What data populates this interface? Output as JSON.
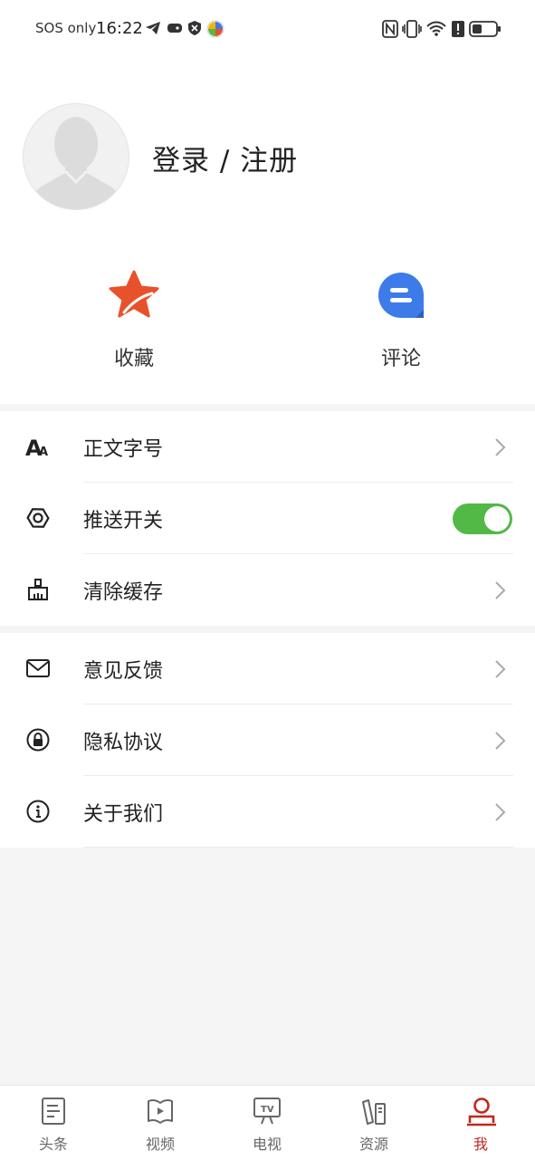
{
  "status_bar": {
    "carrier": "SOS only",
    "time": "16:22"
  },
  "profile": {
    "login_label": "登录 / 注册"
  },
  "quick_actions": [
    {
      "label": "收藏",
      "icon": "star-icon"
    },
    {
      "label": "评论",
      "icon": "comment-icon"
    }
  ],
  "settings": [
    {
      "label": "正文字号",
      "icon": "font-size-icon",
      "control": "chevron"
    },
    {
      "label": "推送开关",
      "icon": "hexagon-icon",
      "control": "toggle",
      "toggle_on": true
    },
    {
      "label": "清除缓存",
      "icon": "broom-icon",
      "control": "chevron"
    }
  ],
  "more": [
    {
      "label": "意见反馈",
      "icon": "mail-icon"
    },
    {
      "label": "隐私协议",
      "icon": "lock-icon"
    },
    {
      "label": "关于我们",
      "icon": "info-icon"
    }
  ],
  "tabs": [
    {
      "label": "头条",
      "icon": "article-icon",
      "active": false
    },
    {
      "label": "视频",
      "icon": "video-book-icon",
      "active": false
    },
    {
      "label": "电视",
      "icon": "tv-icon",
      "active": false
    },
    {
      "label": "资源",
      "icon": "resources-icon",
      "active": false
    },
    {
      "label": "我",
      "icon": "profile-icon",
      "active": true
    }
  ],
  "colors": {
    "accent": "#c2271f",
    "toggle_on": "#52b846",
    "comment_blue": "#3d7be8",
    "star_orange": "#e8522b"
  }
}
